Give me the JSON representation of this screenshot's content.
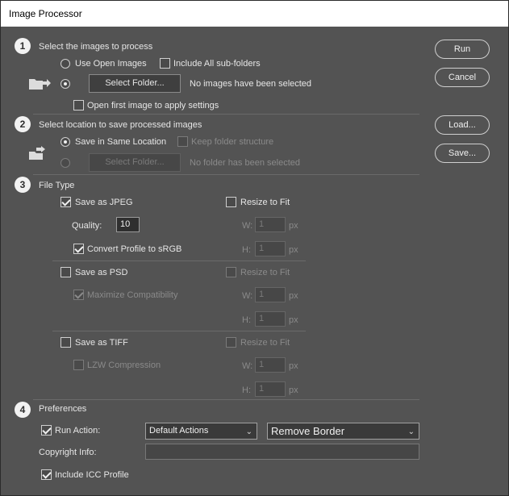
{
  "window": {
    "title": "Image Processor"
  },
  "section1": {
    "number": "1",
    "heading": "Select the images to process",
    "use_open_images": "Use Open Images",
    "include_subfolders": "Include All sub-folders",
    "select_folder_button": "Select Folder...",
    "status": "No images have been selected",
    "open_first_image": "Open first image to apply settings"
  },
  "section2": {
    "number": "2",
    "heading": "Select location to save processed images",
    "save_same_location": "Save in Same Location",
    "keep_folder_structure": "Keep folder structure",
    "select_folder_button": "Select Folder...",
    "status": "No folder has been selected"
  },
  "section3": {
    "number": "3",
    "heading": "File Type",
    "jpeg": {
      "save_label": "Save as JPEG",
      "resize_label": "Resize to Fit",
      "quality_label": "Quality:",
      "quality_value": "10",
      "w_label": "W:",
      "w_value": "1",
      "h_label": "H:",
      "h_value": "1",
      "unit": "px",
      "convert_label": "Convert Profile to sRGB"
    },
    "psd": {
      "save_label": "Save as PSD",
      "resize_label": "Resize to Fit",
      "maximize_label": "Maximize Compatibility",
      "w_label": "W:",
      "w_value": "1",
      "h_label": "H:",
      "h_value": "1",
      "unit": "px"
    },
    "tiff": {
      "save_label": "Save as TIFF",
      "resize_label": "Resize to Fit",
      "lzw_label": "LZW Compression",
      "w_label": "W:",
      "w_value": "1",
      "h_label": "H:",
      "h_value": "1",
      "unit": "px"
    }
  },
  "section4": {
    "number": "4",
    "heading": "Preferences",
    "run_action_label": "Run Action:",
    "action_set": "Default Actions",
    "action": "Remove Border",
    "copyright_label": "Copyright Info:",
    "copyright_value": "",
    "include_icc": "Include ICC Profile"
  },
  "buttons": {
    "run": "Run",
    "cancel": "Cancel",
    "load": "Load...",
    "save": "Save..."
  },
  "icons": {
    "folder": "folder-arrow-icon",
    "chevron": "chevron-down-icon"
  },
  "colors": {
    "panel": "#535353",
    "titlebar": "#ffffff"
  }
}
